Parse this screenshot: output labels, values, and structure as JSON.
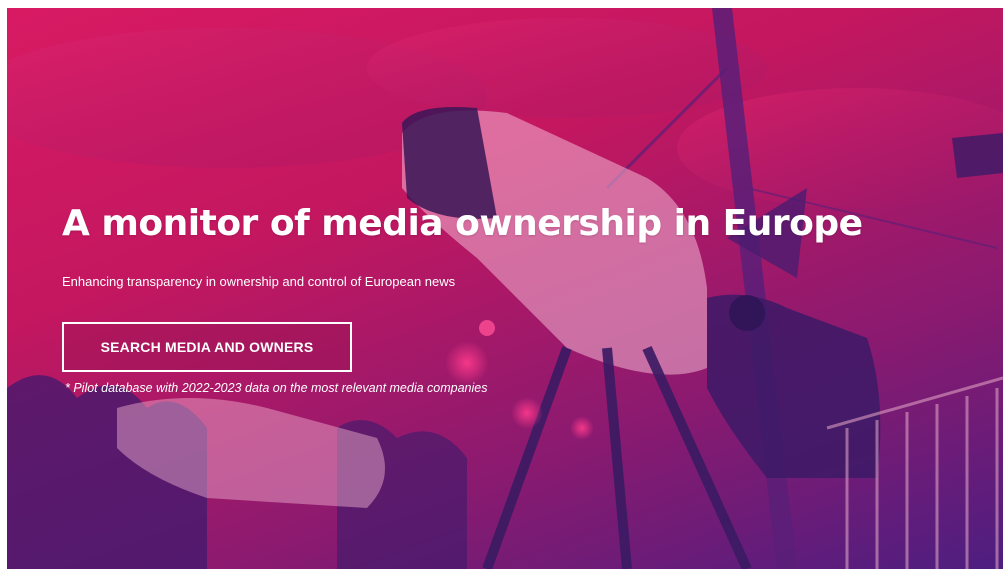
{
  "hero": {
    "headline": "A monitor of media ownership in Europe",
    "subheadline": "Enhancing transparency in ownership and control of European news",
    "cta_label": "SEARCH MEDIA AND OWNERS",
    "footnote": "* Pilot database with 2022-2023 data on the most relevant media companies",
    "background_image": "tv-camera-crew-photo",
    "overlay_color": "#d81a63",
    "overlay_color_dark": "#4d1e80"
  }
}
